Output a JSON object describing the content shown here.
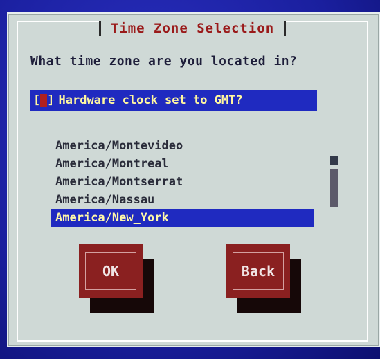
{
  "dialog": {
    "title": "Time Zone Selection",
    "question": "What time zone are you located in?"
  },
  "gmt_option": {
    "label": "Hardware clock set to GMT?",
    "checkbox_left": "[",
    "checkbox_right": "]"
  },
  "timezones": {
    "items": [
      "America/Montevideo",
      "America/Montreal",
      "America/Montserrat",
      "America/Nassau",
      "America/New_York"
    ],
    "selected": "America/New_York"
  },
  "buttons": {
    "ok_label": "OK",
    "back_label": "Back"
  }
}
